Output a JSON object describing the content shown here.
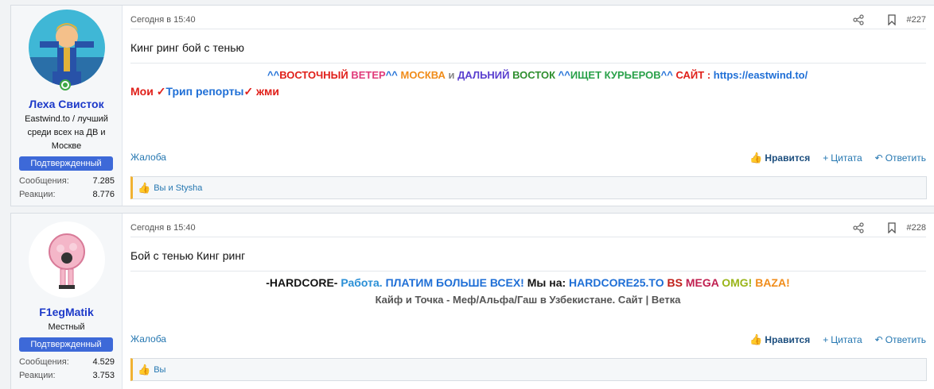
{
  "posts": [
    {
      "user": {
        "name": "Леха Свисток",
        "title": "Eastwind.to / лучший среди всех на ДВ и Москве",
        "badge": "Подтвержденный",
        "messages_label": "Сообщения:",
        "messages": "7.285",
        "reactions_label": "Реакции:",
        "reactions": "8.776"
      },
      "date": "Сегодня в 15:40",
      "number": "#227",
      "text": "Кинг ринг бой с тенью",
      "signature": {
        "line1": [
          {
            "t": "^^",
            "c": "#1f6fd6"
          },
          {
            "t": "ВОСТОЧНЫЙ ",
            "c": "#e0201a"
          },
          {
            "t": "ВЕТЕР",
            "c": "#e03a7a"
          },
          {
            "t": "^^ ",
            "c": "#1f6fd6"
          },
          {
            "t": "МОСКВА",
            "c": "#f08c1a"
          },
          {
            "t": " и ",
            "c": "#888888"
          },
          {
            "t": "ДАЛЬНИЙ ",
            "c": "#5a3fcf"
          },
          {
            "t": "ВОСТОК",
            "c": "#2f8f2f"
          },
          {
            "t": " ^^",
            "c": "#1f6fd6"
          },
          {
            "t": "ИЩЕТ КУРЬЕРОВ",
            "c": "#2aa14a"
          },
          {
            "t": "^^ ",
            "c": "#1f6fd6"
          },
          {
            "t": "САЙТ : ",
            "c": "#e0201a"
          },
          {
            "t": "https://eastwind.to/",
            "c": "#1f6fd6"
          }
        ],
        "line2": [
          {
            "t": "Мои ✓",
            "c": "#e0201a"
          },
          {
            "t": "Трип репорты",
            "c": "#1f6fd6"
          },
          {
            "t": "✓ жми",
            "c": "#e0201a"
          }
        ]
      },
      "report": "Жалоба",
      "like": "Нравится",
      "quote": "Цитата",
      "reply": "Ответить",
      "reactions_text": "Вы и Stysha"
    },
    {
      "user": {
        "name": "F1egMatik",
        "title": "Местный",
        "badge": "Подтвержденный",
        "messages_label": "Сообщения:",
        "messages": "4.529",
        "reactions_label": "Реакции:",
        "reactions": "3.753"
      },
      "date": "Сегодня в 15:40",
      "number": "#228",
      "text": "Бой с тенью Кинг ринг",
      "signature": {
        "line1": [
          {
            "t": "-HARDCORE- ",
            "c": "#141414"
          },
          {
            "t": "Работа. ",
            "c": "#2a8fd6"
          },
          {
            "t": "ПЛАТИМ БОЛЬШЕ ВСЕХ! ",
            "c": "#1f6fd6"
          },
          {
            "t": "Мы на: ",
            "c": "#141414"
          },
          {
            "t": "HARDCORE25.TO ",
            "c": "#1f6fd6"
          },
          {
            "t": "BS ",
            "c": "#c0201a"
          },
          {
            "t": "MEGA ",
            "c": "#c02050"
          },
          {
            "t": "OMG! ",
            "c": "#9ab51a"
          },
          {
            "t": "BAZA!",
            "c": "#f08c1a"
          }
        ],
        "line2": "Кайф и Точка - Меф/Альфа/Гаш в Узбекистане. Сайт | Ветка"
      },
      "report": "Жалоба",
      "like": "Нравится",
      "quote": "Цитата",
      "reply": "Ответить",
      "reactions_text": "Вы"
    }
  ]
}
